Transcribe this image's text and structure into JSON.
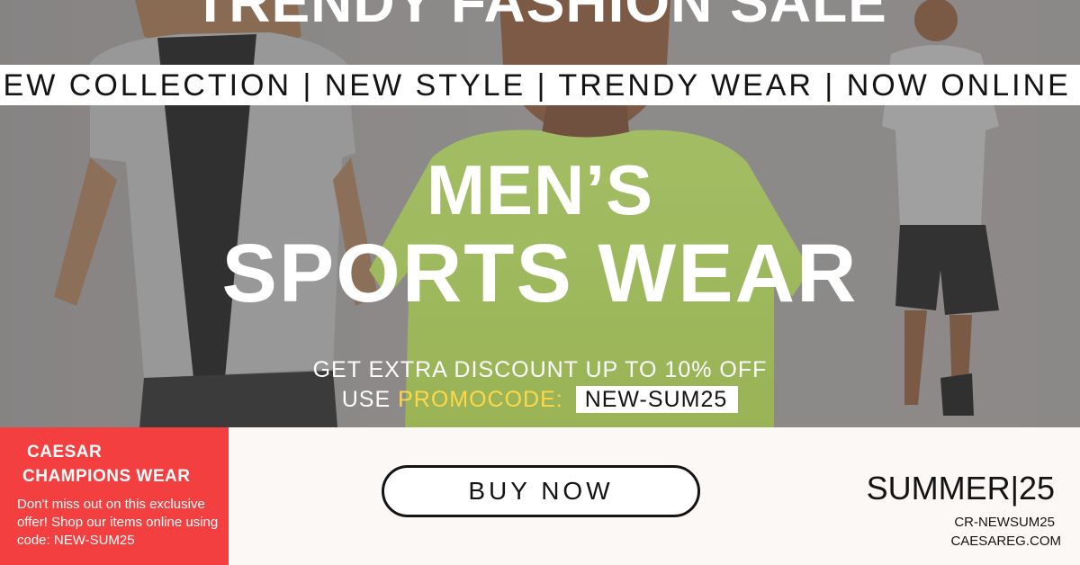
{
  "banner": {
    "top_title": "TRENDY FASHION SALE",
    "ticker": "NEW COLLECTION | NEW STYLE | TRENDY WEAR | NOW ONLINE",
    "headline_line1": "MEN’S",
    "headline_line2": "SPORTS WEAR",
    "discount_text": "GET EXTRA DISCOUNT UP TO 10% OFF",
    "promo_use": "USE",
    "promo_word": "PROMOCODE:",
    "promo_code": "NEW-SUM25"
  },
  "brand": {
    "name_line1": "CAESAR",
    "name_line2": "CHAMPIONS WEAR",
    "offer_text": "Don't miss out on this exclusive offer! Shop our items online using code: NEW-SUM25"
  },
  "cta": {
    "label": "BUY NOW"
  },
  "side": {
    "season": "SUMMER|25",
    "code": "CR-NEWSUM25",
    "website": "CAESAREG.COM"
  },
  "colors": {
    "accent_red": "#f33f3f",
    "promo_yellow": "#ffd84a",
    "neon_shirt": "#c9f56a",
    "background": "#fbf8f6"
  },
  "images": {
    "left_model": "man-back-grey-tshirt",
    "center_model": "man-neon-green-tshirt",
    "right_model": "man-walking-grey-tshirt-black-shorts"
  }
}
